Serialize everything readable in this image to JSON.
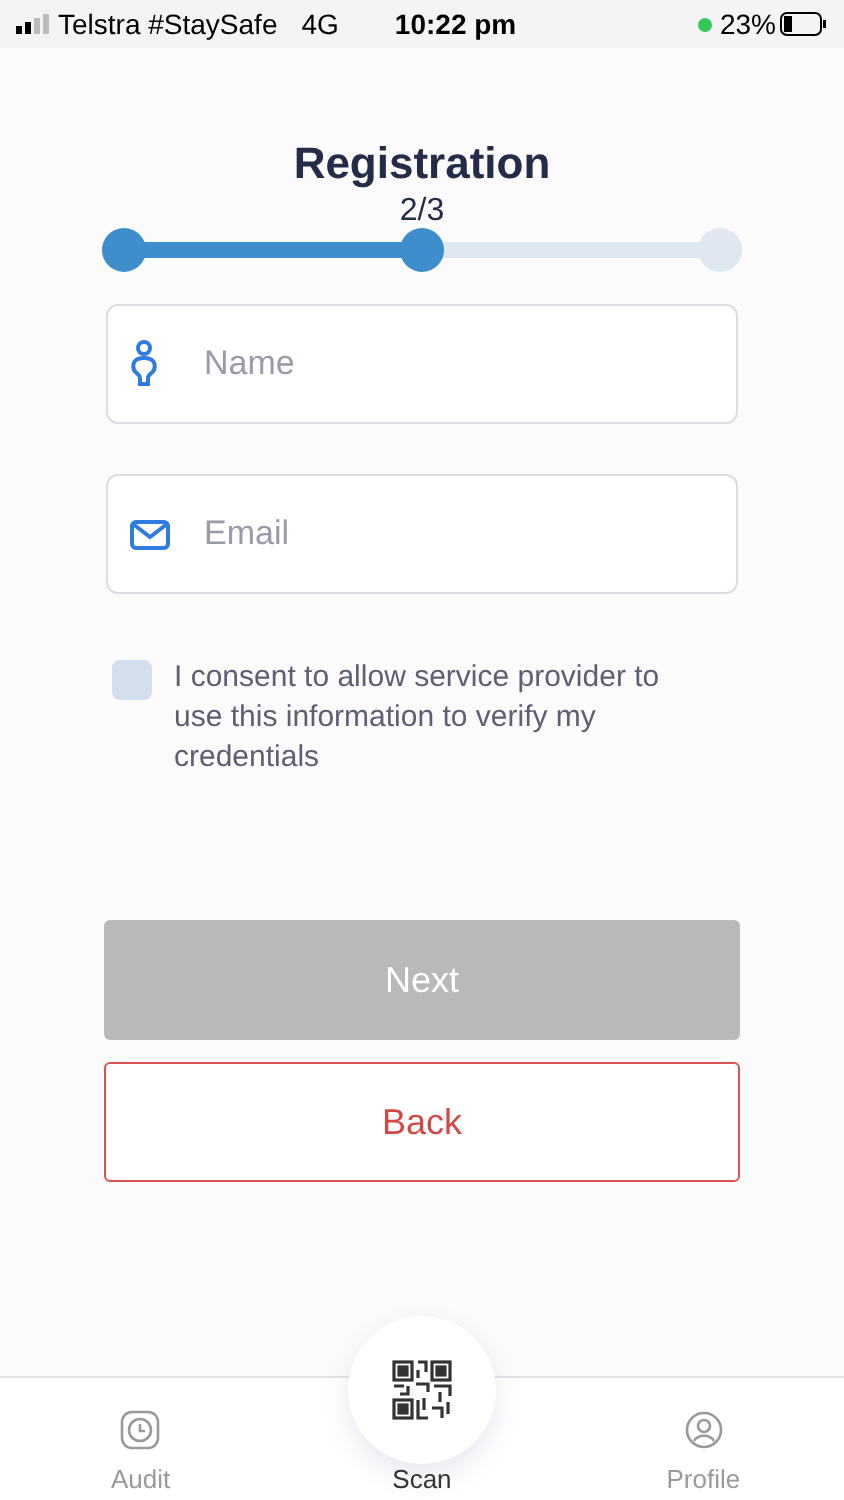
{
  "status_bar": {
    "carrier": "Telstra #StaySafe",
    "network": "4G",
    "time": "10:22 pm",
    "battery": "23%"
  },
  "title": "Registration",
  "progress": {
    "label": "2/3",
    "level": 0.5,
    "steps": [
      {
        "done": true
      },
      {
        "done": true
      },
      {
        "done": false
      }
    ]
  },
  "fields": [
    {
      "kind": "person",
      "placeholder": "Name"
    },
    {
      "kind": "email",
      "placeholder": "Email"
    }
  ],
  "consent": {
    "checked": false,
    "label": "I consent to allow service provider to use this information to verify my credentials"
  },
  "buttons": [
    {
      "kind": "primary",
      "label": "Next",
      "disabled": true
    },
    {
      "kind": "outline",
      "label": "Back",
      "disabled": false
    }
  ],
  "nav": [
    {
      "kind": "audit",
      "label": "Audit",
      "selected": false
    },
    {
      "kind": "scan",
      "label": "Scan",
      "selected": true
    },
    {
      "kind": "profile",
      "label": "Profile",
      "selected": false
    }
  ]
}
